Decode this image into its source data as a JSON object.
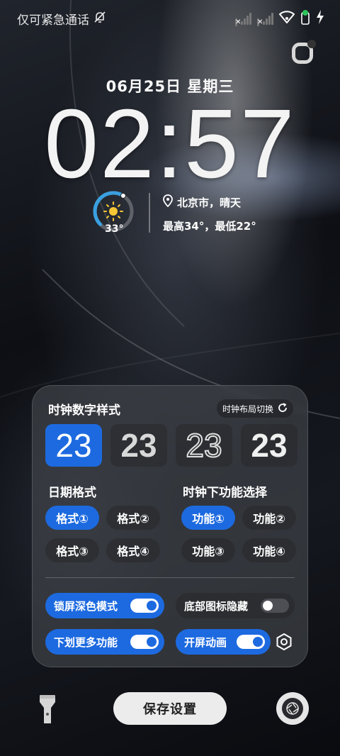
{
  "status_bar": {
    "emergency_text": "仅可紧急通话",
    "icons": [
      "no-sim-signal-icon",
      "no-sim-signal-icon",
      "wifi-icon",
      "battery-icon",
      "charging-icon"
    ]
  },
  "lockscreen": {
    "date": "06月25日 星期三",
    "time": "02:57",
    "weather": {
      "temperature": "33°",
      "location": "北京市，晴天",
      "range": "最高34°，最低22°",
      "icon": "sun-icon",
      "gauge_fraction": 0.62
    }
  },
  "panel": {
    "title": "时钟数字样式",
    "layout_switch": "时钟布局切换",
    "digit_styles": [
      {
        "label": "23",
        "selected": true
      },
      {
        "label": "23",
        "selected": false
      },
      {
        "label": "23",
        "selected": false
      },
      {
        "label": "23",
        "selected": false
      }
    ],
    "date_format": {
      "title": "日期格式",
      "options": [
        "格式①",
        "格式②",
        "格式③",
        "格式④"
      ],
      "selected_index": 0
    },
    "clock_function": {
      "title": "时钟下功能选择",
      "options": [
        "功能①",
        "功能②",
        "功能③",
        "功能④"
      ],
      "selected_index": 0
    },
    "toggles": [
      {
        "label": "锁屏深色模式",
        "on": true
      },
      {
        "label": "底部图标隐藏",
        "on": false
      },
      {
        "label": "下划更多功能",
        "on": true
      },
      {
        "label": "开屏动画",
        "on": true
      }
    ]
  },
  "bottom": {
    "save_label": "保存设置"
  },
  "colors": {
    "accent": "#1d6ae0",
    "gauge": "#3aa0e0"
  }
}
